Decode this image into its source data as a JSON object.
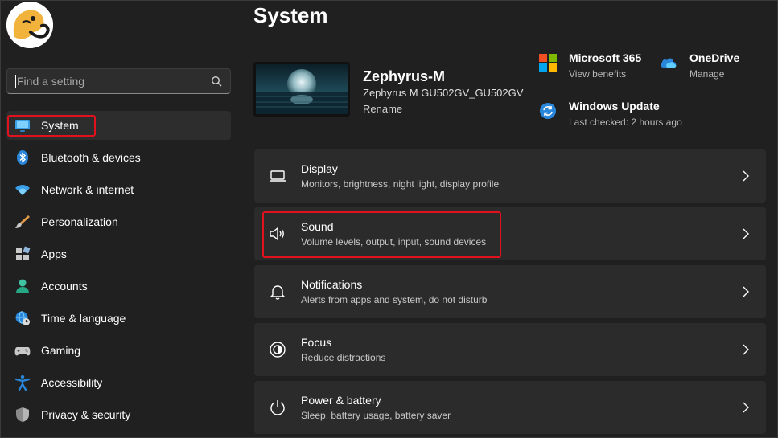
{
  "search": {
    "placeholder": "Find a setting"
  },
  "sidebar": {
    "items": [
      {
        "label": "System",
        "icon": "monitor-icon"
      },
      {
        "label": "Bluetooth & devices",
        "icon": "bluetooth-icon"
      },
      {
        "label": "Network & internet",
        "icon": "wifi-icon"
      },
      {
        "label": "Personalization",
        "icon": "brush-icon"
      },
      {
        "label": "Apps",
        "icon": "apps-icon"
      },
      {
        "label": "Accounts",
        "icon": "person-icon"
      },
      {
        "label": "Time & language",
        "icon": "globe-clock-icon"
      },
      {
        "label": "Gaming",
        "icon": "gamepad-icon"
      },
      {
        "label": "Accessibility",
        "icon": "accessibility-icon"
      },
      {
        "label": "Privacy & security",
        "icon": "shield-icon"
      }
    ]
  },
  "main": {
    "title": "System",
    "device": {
      "name": "Zephyrus-M",
      "model": "Zephyrus M GU502GV_GU502GV",
      "rename": "Rename"
    },
    "quick_links": {
      "ms365": {
        "title": "Microsoft 365",
        "sub": "View benefits"
      },
      "onedrive": {
        "title": "OneDrive",
        "sub": "Manage"
      },
      "update": {
        "title": "Windows Update",
        "sub": "Last checked: 2 hours ago"
      }
    },
    "cards": [
      {
        "title": "Display",
        "sub": "Monitors, brightness, night light, display profile",
        "icon": "display-icon"
      },
      {
        "title": "Sound",
        "sub": "Volume levels, output, input, sound devices",
        "icon": "speaker-icon"
      },
      {
        "title": "Notifications",
        "sub": "Alerts from apps and system, do not disturb",
        "icon": "bell-icon"
      },
      {
        "title": "Focus",
        "sub": "Reduce distractions",
        "icon": "focus-icon"
      },
      {
        "title": "Power & battery",
        "sub": "Sleep, battery usage, battery saver",
        "icon": "power-icon"
      }
    ]
  },
  "colors": {
    "accent": "#60cdff",
    "highlight": "#e3101e",
    "background": "#202020",
    "card": "#2b2b2b"
  }
}
